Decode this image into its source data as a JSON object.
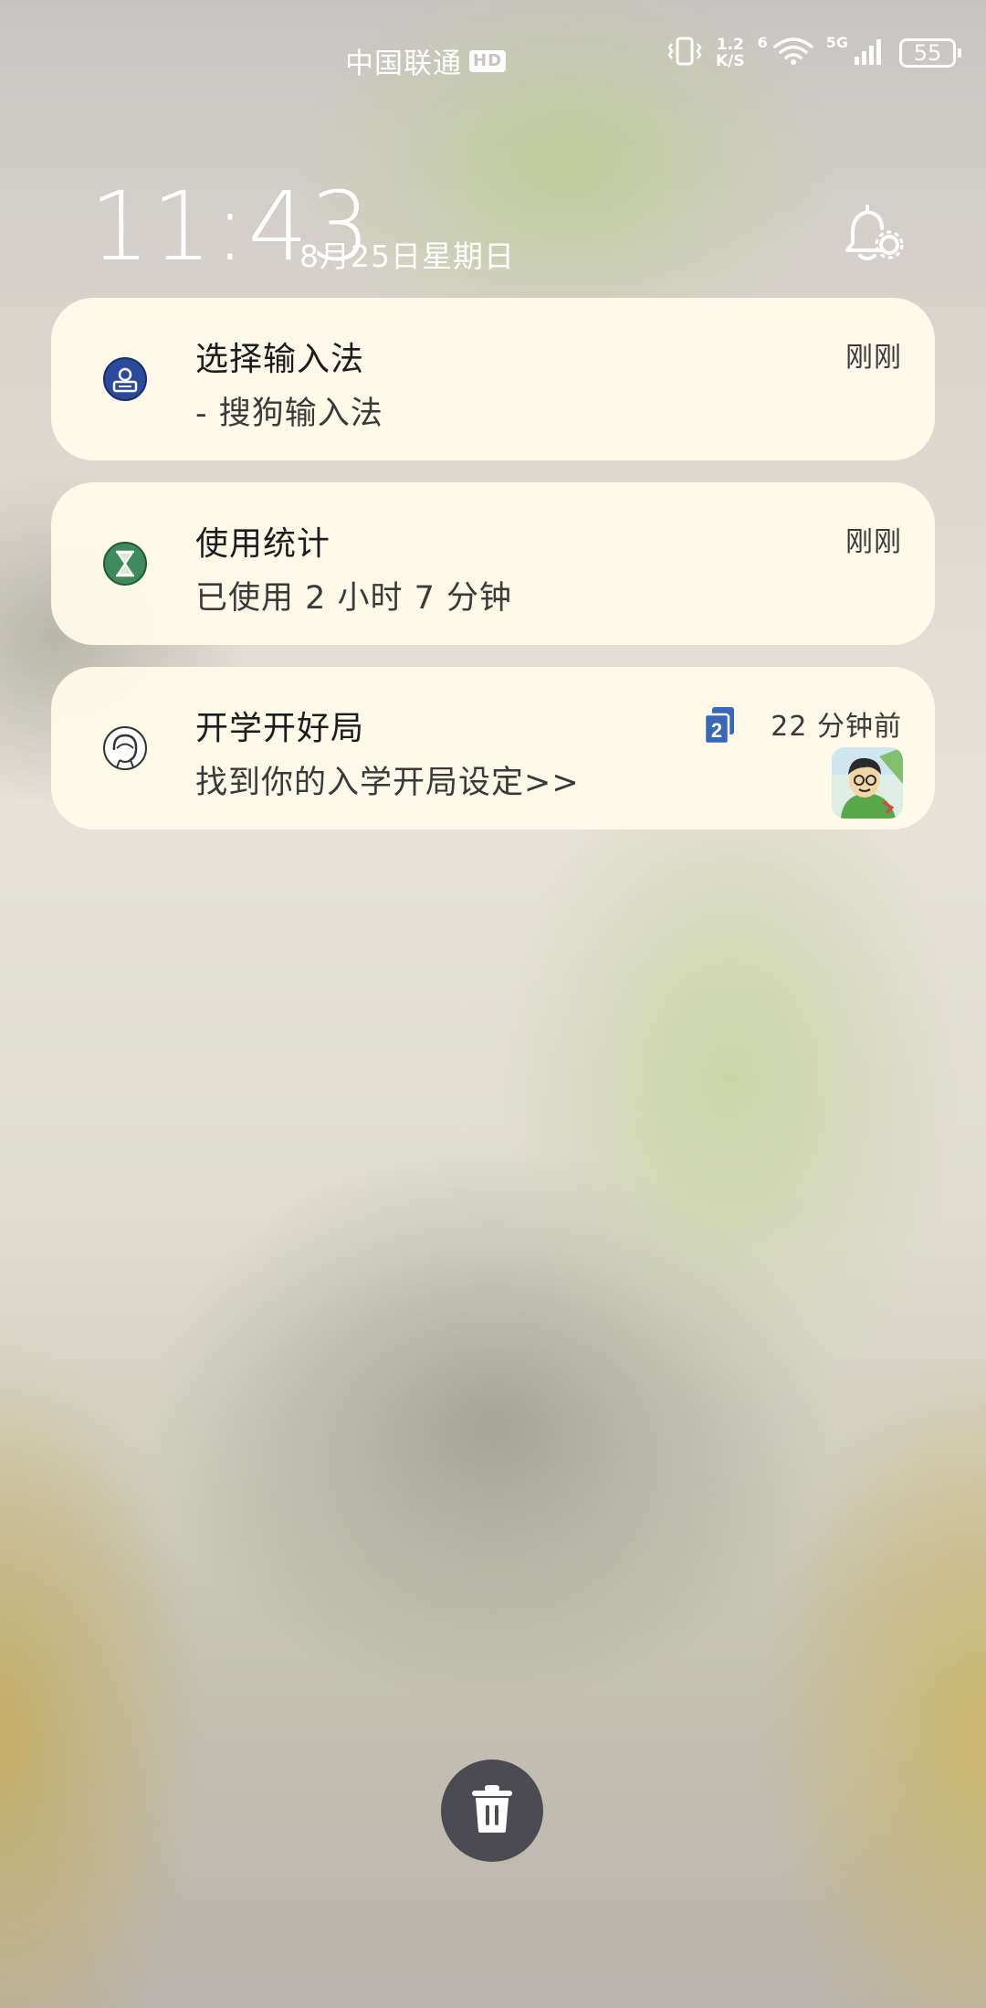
{
  "status_bar": {
    "carrier": "中国联通",
    "hd_label": "HD",
    "speed_value": "1.2",
    "speed_unit": "K/S",
    "wifi_label": "6",
    "network_label": "5G",
    "battery": "55"
  },
  "lockscreen": {
    "time": "11:43",
    "date": "8月25日星期日"
  },
  "notifications": [
    {
      "title": "选择输入法",
      "body": "- 搜狗输入法",
      "time": "刚刚",
      "icon": "keyboard-icon",
      "icon_color": "#2b4a9a"
    },
    {
      "title": "使用统计",
      "body": "已使用 2 小时 7 分钟",
      "time": "刚刚",
      "icon": "hourglass-icon",
      "icon_color": "#3f8a5a"
    },
    {
      "title": "开学开好局",
      "body": "找到你的入学开局设定>>",
      "time": "22 分钟前",
      "icon": "girl-avatar-icon",
      "count": "2",
      "count_color": "#3a68b8"
    }
  ],
  "colors": {
    "card_bg": "#fffcec",
    "clear_button": "#4c4a52"
  }
}
